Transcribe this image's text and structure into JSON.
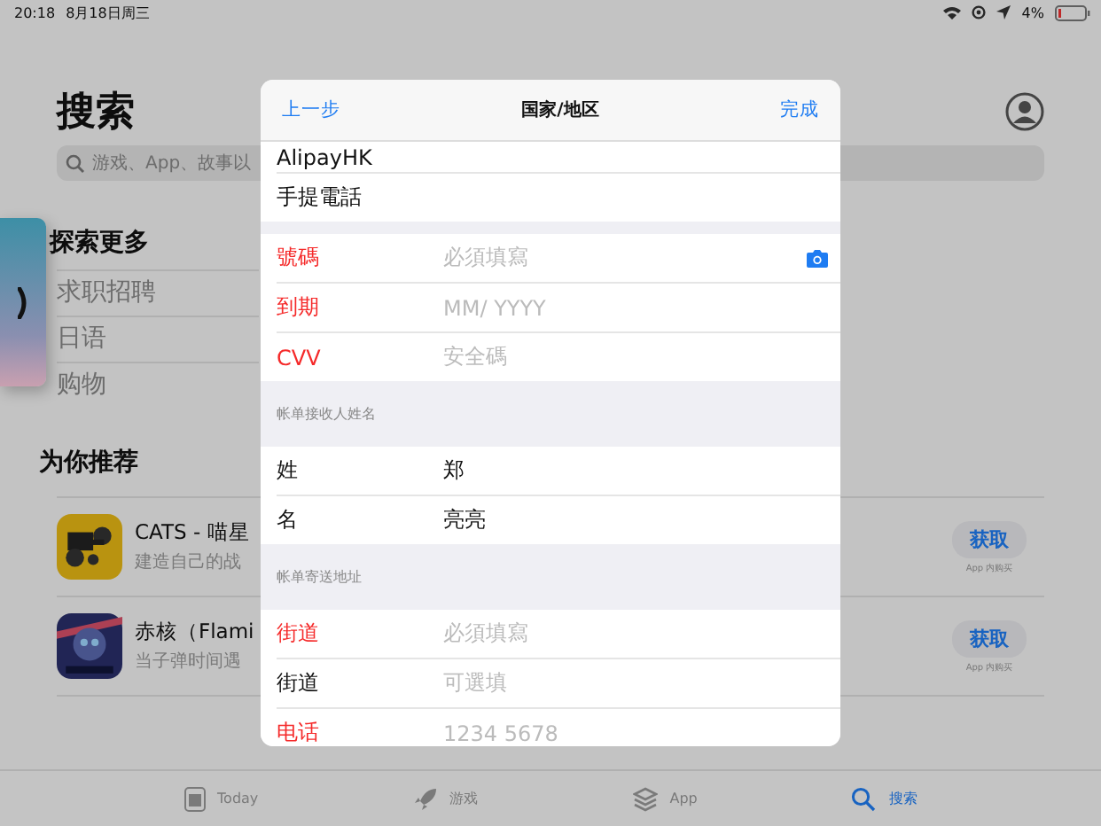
{
  "status_bar": {
    "time": "20:18",
    "date": "8月18日周三",
    "battery": "4%"
  },
  "page": {
    "title": "搜索",
    "search_placeholder": "游戏、App、故事以",
    "explore_title": "探索更多",
    "explore_items": [
      "求职招聘",
      "日语",
      "购物"
    ],
    "recommend_title": "为你推荐",
    "apps": [
      {
        "name": "CATS - 喵星",
        "subtitle": "建造自己的战",
        "button": "获取",
        "note": "App 内购买",
        "kind": "cats"
      },
      {
        "name": "赤核（Flami",
        "subtitle": "当子弹时间遇",
        "button": "获取",
        "note": "App 内购买",
        "kind": "core"
      }
    ]
  },
  "tab_bar": [
    {
      "label": "Today",
      "kind": "today",
      "selected": false
    },
    {
      "label": "游戏",
      "kind": "games",
      "selected": false
    },
    {
      "label": "App",
      "kind": "apps",
      "selected": false
    },
    {
      "label": "搜索",
      "kind": "search",
      "selected": true
    }
  ],
  "modal": {
    "back": "上一步",
    "title": "国家/地区",
    "done": "完成",
    "sections": [
      {
        "rows": [
          {
            "label": "AlipayHK",
            "required": false
          },
          {
            "label": "手提電話",
            "required": false
          }
        ]
      },
      {
        "rows": [
          {
            "label": "號碼",
            "placeholder": "必須填寫",
            "required": true,
            "camera": true
          },
          {
            "label": "到期",
            "placeholder": "MM/ YYYY",
            "required": true
          },
          {
            "label": "CVV",
            "placeholder": "安全碼",
            "required": true
          }
        ]
      },
      {
        "header": "帐单接收人姓名",
        "rows": [
          {
            "label": "姓",
            "value": "郑",
            "required": false
          },
          {
            "label": "名",
            "value": "亮亮",
            "required": false
          }
        ]
      },
      {
        "header": "帐单寄送地址",
        "rows": [
          {
            "label": "街道",
            "placeholder": "必須填寫",
            "required": true
          },
          {
            "label": "街道",
            "placeholder": "可選填",
            "required": false
          },
          {
            "label": "电话",
            "placeholder": "1234 5678",
            "required": true
          }
        ]
      }
    ]
  }
}
